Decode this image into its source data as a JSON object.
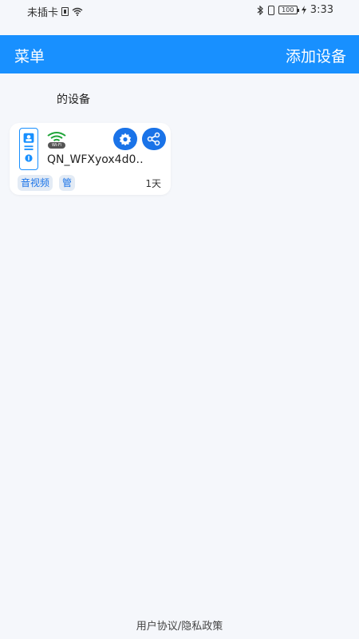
{
  "status_bar": {
    "carrier": "未插卡",
    "battery": "100",
    "time": "3:33"
  },
  "header": {
    "menu_label": "菜单",
    "add_device_label": "添加设备"
  },
  "section": {
    "title": "的设备"
  },
  "device_card": {
    "name": "QN_WFXyox4d0…",
    "wifi_badge": "Wi-Fi",
    "tags": [
      "音视频",
      "管"
    ],
    "online_duration": "1天"
  },
  "footer": {
    "user_agreement": "用户协议",
    "separator": "/",
    "privacy_policy": "隐私政策"
  },
  "colors": {
    "primary": "#1890ff",
    "button_blue": "#1a73e8",
    "background": "#f5f7fb"
  }
}
